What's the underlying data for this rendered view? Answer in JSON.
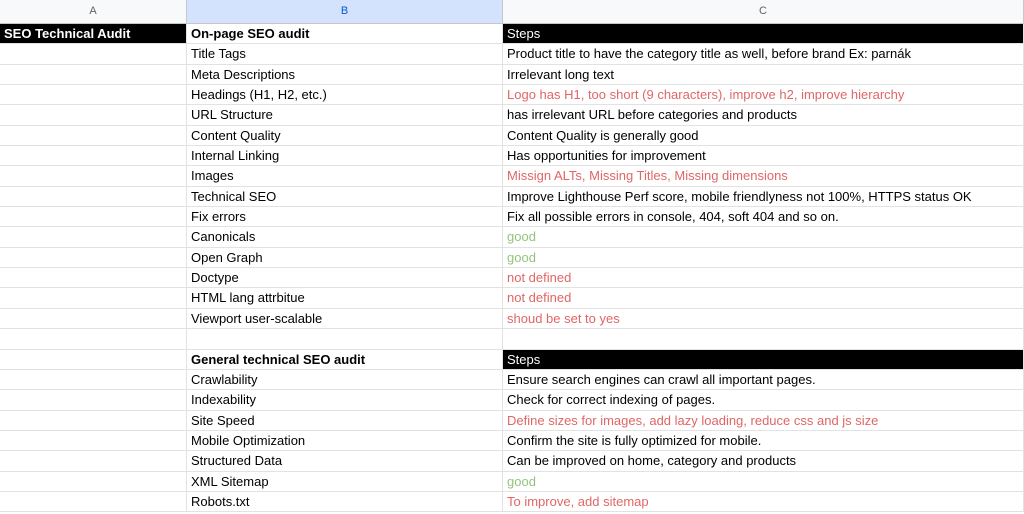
{
  "columns": [
    "A",
    "B",
    "C"
  ],
  "colors": {
    "red": "#e06666",
    "green": "#93c47d",
    "header_bg": "#000000",
    "selected_col": "#d3e3fd"
  },
  "rows": [
    {
      "a": "SEO Technical Audit",
      "b": "On-page SEO audit",
      "c": "Steps",
      "type": "header"
    },
    {
      "a": "",
      "b": "Title Tags",
      "c": "Product title to have the category title as well, before brand Ex: parnák",
      "status": "normal"
    },
    {
      "a": "",
      "b": "Meta Descriptions",
      "c": "Irrelevant long text",
      "status": "normal"
    },
    {
      "a": "",
      "b": "Headings (H1, H2, etc.)",
      "c": "Logo has H1, too short (9 characters), improve h2, improve hierarchy",
      "status": "red"
    },
    {
      "a": "",
      "b": "URL Structure",
      "c": "has irrelevant URL before categories and products",
      "status": "normal"
    },
    {
      "a": "",
      "b": "Content Quality",
      "c": "Content Quality is generally good",
      "status": "normal"
    },
    {
      "a": "",
      "b": "Internal Linking",
      "c": "Has opportunities for improvement",
      "status": "normal"
    },
    {
      "a": "",
      "b": "Images",
      "c": "Missign ALTs, Missing Titles, Missing dimensions",
      "status": "red"
    },
    {
      "a": "",
      "b": "Technical SEO",
      "c": "Improve Lighthouse Perf score, mobile friendlyness not 100%, HTTPS status OK",
      "status": "normal"
    },
    {
      "a": "",
      "b": "Fix errors",
      "c": "Fix all possible errors in console, 404, soft 404 and so on.",
      "status": "normal"
    },
    {
      "a": "",
      "b": "Canonicals",
      "c": "good",
      "status": "green"
    },
    {
      "a": "",
      "b": "Open Graph",
      "c": "good",
      "status": "green"
    },
    {
      "a": "",
      "b": "Doctype",
      "c": "not defined",
      "status": "red"
    },
    {
      "a": "",
      "b": "HTML lang attrbitue",
      "c": "not defined",
      "status": "red"
    },
    {
      "a": "",
      "b": "Viewport user-scalable",
      "c": "shoud be set to yes",
      "status": "red"
    },
    {
      "a": "",
      "b": "",
      "c": "",
      "status": "empty"
    },
    {
      "a": "",
      "b": "General technical SEO audit",
      "c": "Steps",
      "type": "subheader"
    },
    {
      "a": "",
      "b": "Crawlability",
      "c": "Ensure search engines can crawl all important pages.",
      "status": "normal"
    },
    {
      "a": "",
      "b": "Indexability",
      "c": "Check for correct indexing of pages.",
      "status": "normal"
    },
    {
      "a": "",
      "b": "Site Speed",
      "c": "Define sizes for images, add lazy loading, reduce css and js size",
      "status": "red"
    },
    {
      "a": "",
      "b": "Mobile Optimization",
      "c": "Confirm the site is fully optimized for mobile.",
      "status": "normal"
    },
    {
      "a": "",
      "b": "Structured Data",
      "c": "Can be improved on home, category and products",
      "status": "normal"
    },
    {
      "a": "",
      "b": "XML Sitemap",
      "c": "good",
      "status": "green"
    },
    {
      "a": "",
      "b": "Robots.txt",
      "c": "To improve, add sitemap",
      "status": "red"
    }
  ]
}
